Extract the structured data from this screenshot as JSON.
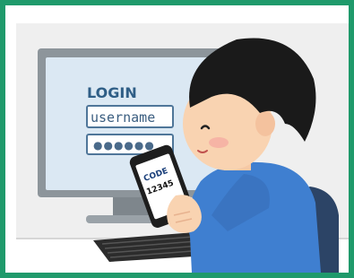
{
  "screen": {
    "title": "LOGIN",
    "username_field": "username",
    "password_mask": "●●●●●●"
  },
  "phone": {
    "label": "CODE",
    "code": "12345"
  },
  "colors": {
    "frame_border": "#1f9a6b",
    "panel_background": "#efefef",
    "monitor_screen": "#dbe8f3",
    "shirt": "#3f7fd0",
    "hair": "#1a1a1a"
  }
}
